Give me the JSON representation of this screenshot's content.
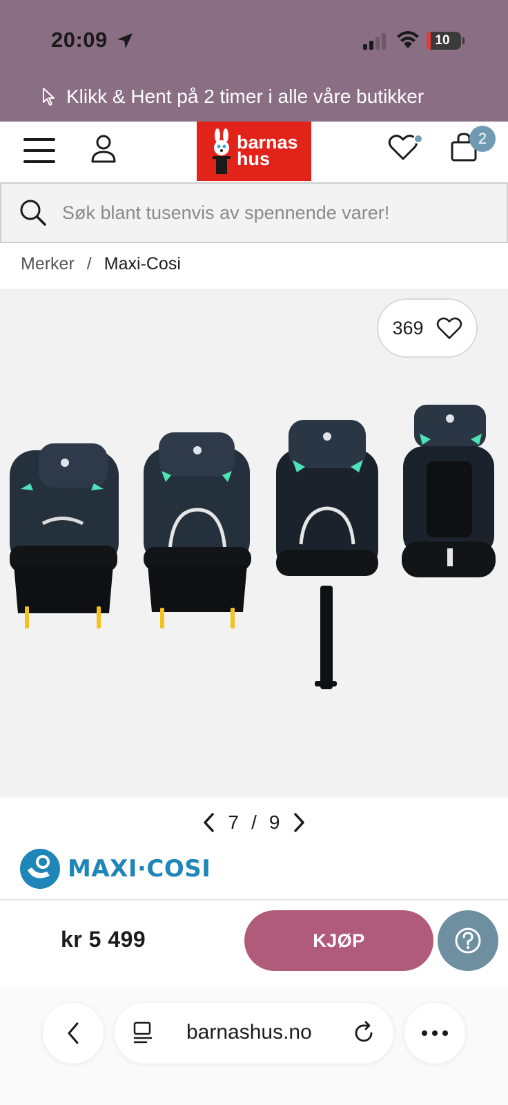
{
  "status_bar": {
    "time": "20:09",
    "battery": "10"
  },
  "promo": {
    "text": "Klikk & Hent på 2 timer i alle våre butikker"
  },
  "header": {
    "logo_line1": "barnas",
    "logo_line2": "hus",
    "cart_count": "2"
  },
  "search": {
    "placeholder": "Søk blant tusenvis av spennende varer!"
  },
  "breadcrumb": {
    "parent": "Merker",
    "separator": "/",
    "current": "Maxi-Cosi"
  },
  "gallery": {
    "favorites_count": "369"
  },
  "pager": {
    "current": "7",
    "separator": "/",
    "total": "9"
  },
  "brand": {
    "name": "MAXI·COSI"
  },
  "buy_bar": {
    "price": "kr 5 499",
    "buy_label": "KJØP"
  },
  "browser": {
    "domain": "barnashus.no"
  },
  "colors": {
    "promo_bg": "#8a6e84",
    "logo_red": "#e2231a",
    "buy_button": "#b05b79",
    "help_button": "#6d8fa0",
    "brand_blue": "#1e86b9",
    "badge": "#6f9ab1"
  },
  "icons": [
    "location-arrow-icon",
    "cursor-icon",
    "hamburger-icon",
    "user-icon",
    "heart-icon",
    "bag-icon",
    "search-icon",
    "chevron-left-icon",
    "chevron-right-icon",
    "question-icon",
    "reader-icon",
    "reload-icon",
    "more-icon"
  ]
}
